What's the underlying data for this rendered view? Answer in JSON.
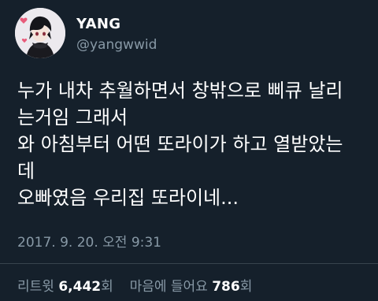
{
  "user": {
    "display_name": "YANG",
    "handle": "@yangwwid",
    "avatar_icon": "avatar-image"
  },
  "tweet": {
    "lines": [
      "누가 내차 추월하면서 창밖으로 삐큐 날리",
      "는거임 그래서",
      "와 아침부터 어떤 또라이가 하고 열받았는",
      "데",
      "오빠였음 우리집 또라이네..."
    ],
    "timestamp": "2017. 9. 20. 오전 9:31"
  },
  "stats": {
    "retweets_label": "리트윗",
    "retweets_count": "6,442",
    "retweets_unit": "회",
    "likes_label": "마음에 들어요",
    "likes_count": "786",
    "likes_unit": "회"
  },
  "colors": {
    "background": "#15202b",
    "text": "#ffffff",
    "secondary_text": "#8899a6",
    "divider": "#38444d"
  }
}
